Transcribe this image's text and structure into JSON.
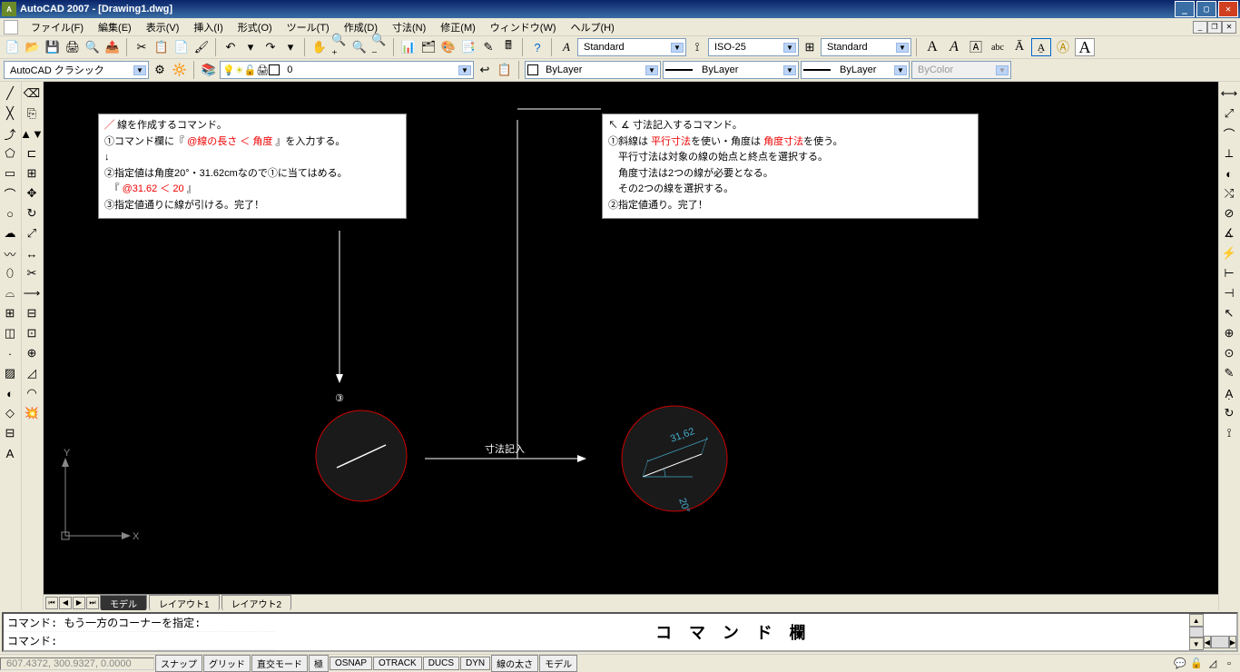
{
  "title": "AutoCAD 2007 - [Drawing1.dwg]",
  "menus": [
    "ファイル(F)",
    "編集(E)",
    "表示(V)",
    "挿入(I)",
    "形式(O)",
    "ツール(T)",
    "作成(D)",
    "寸法(N)",
    "修正(M)",
    "ウィンドウ(W)",
    "ヘルプ(H)"
  ],
  "workspace": "AutoCAD クラシック",
  "layer": "0",
  "style_text": "Standard",
  "style_dim": "ISO-25",
  "style_table": "Standard",
  "color": "ByLayer",
  "linetype": "ByLayer",
  "lineweight": "ByLayer",
  "plotstyle": "ByColor",
  "tabs": [
    "モデル",
    "レイアウト1",
    "レイアウト2"
  ],
  "cmd1": "コマンド:  もう一方のコーナーを指定:",
  "cmd2": "コマンド:",
  "cmd_big": "コ マ ン ド 欄",
  "coords": "607.4372, 300.9327, 0.0000",
  "status_btns": [
    "スナップ",
    "グリッド",
    "直交モード",
    "極",
    "OSNAP",
    "OTRACK",
    "DUCS",
    "DYN",
    "線の太さ",
    "モデル"
  ],
  "note1": {
    "l1": "線を作成するコマンド。",
    "l2": "①コマンド欄に『 ",
    "l2r": "@線の長さ ＜ 角度",
    "l2b": " 』を入力する。",
    "l3": "↓",
    "l4": "②指定値は角度20°・31.62cmなので①に当てはめる。",
    "l5": "　『 ",
    "l5r": "@31.62 ＜ 20",
    "l5b": " 』",
    "l6": "③指定値通りに線が引ける。完了！"
  },
  "note2": {
    "l1": "寸法記入するコマンド。",
    "l2": "①斜線は ",
    "l2r1": "平行寸法",
    "l2m": "を使い・角度は ",
    "l2r2": "角度寸法",
    "l2b": "を使う。",
    "l3": "　平行寸法は対象の線の始点と終点を選択する。",
    "l4": "　角度寸法は2つの線が必要となる。",
    "l5": "　その2つの線を選択する。",
    "l6": "②指定値通り。完了！"
  },
  "canvas": {
    "step3": "③",
    "arrow_label": "寸法記入",
    "dim_value": "31,62",
    "dim_angle": "20°",
    "axis_y": "Y",
    "axis_x": "X"
  }
}
